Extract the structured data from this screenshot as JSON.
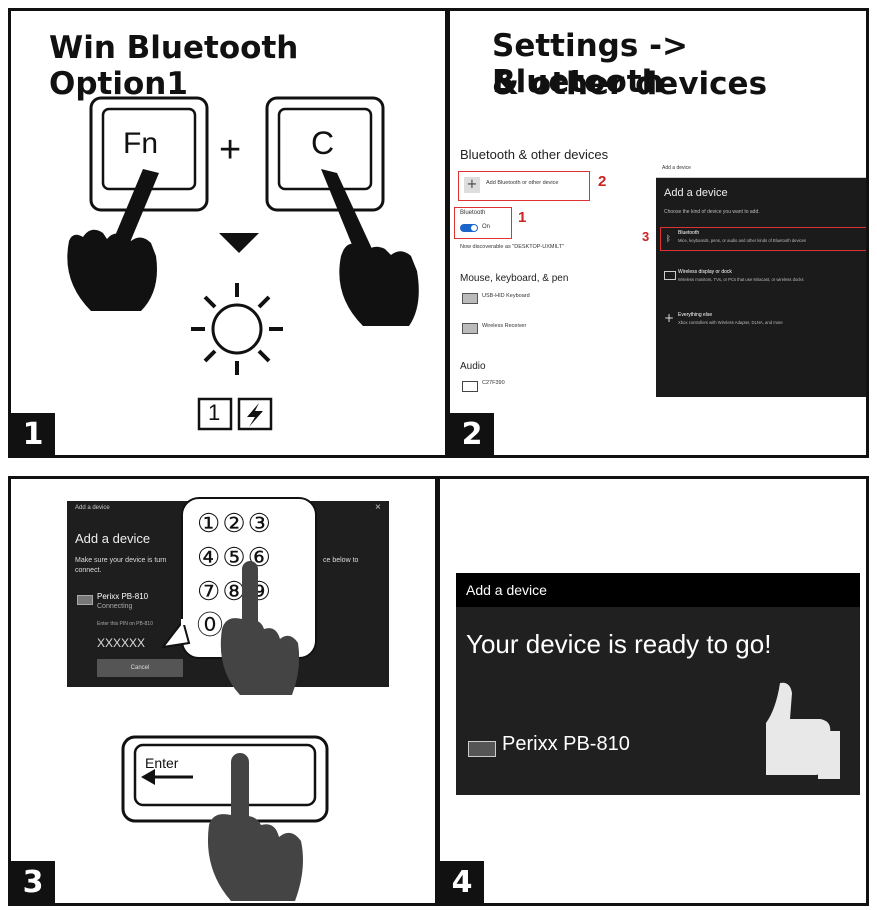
{
  "panel1": {
    "number": "1",
    "title": "Win Bluetooth Option1",
    "key_fn": "Fn",
    "plus": "+",
    "key_c": "C",
    "fkey_label": "1"
  },
  "panel2": {
    "number": "2",
    "title_line1": "Settings -> Bluetooth",
    "title_line2": "& other devices",
    "section_heading": "Bluetooth & other devices",
    "add_device_label": "Add Bluetooth or other device",
    "callout_2": "2",
    "bluetooth_label": "Bluetooth",
    "toggle_state": "On",
    "callout_1": "1",
    "discoverable_text": "Now discoverable as \"DESKTOP-UXMILT\"",
    "mouse_heading": "Mouse, keyboard, & pen",
    "mouse_items": [
      "USB-HID Keyboard",
      "Wireless Receiver"
    ],
    "audio_heading": "Audio",
    "audio_item": "C27F390",
    "dialog": {
      "titlebar": "Add a device",
      "heading": "Add a device",
      "subtext": "Choose the kind of device you want to add.",
      "callout_3": "3",
      "options": [
        {
          "title": "Bluetooth",
          "desc": "Mice, keyboards, pens, or audio and other kinds of Bluetooth devices"
        },
        {
          "title": "Wireless display or dock",
          "desc": "Wireless monitors, TVs, or PCs that use Miracast, or wireless docks"
        },
        {
          "title": "Everything else",
          "desc": "Xbox controllers with Wireless Adapter, DLNA, and more"
        }
      ]
    }
  },
  "panel3": {
    "number": "3",
    "dialog": {
      "titlebar": "Add a device",
      "close": "×",
      "heading": "Add a device",
      "subtext_left": "Make sure your device is turn",
      "subtext_right": "ce below to",
      "subtext_line2": "connect.",
      "device_name": "Perixx PB-810",
      "device_status": "Connecting",
      "pin_prompt": "Enter this PIN on PB-810",
      "pin_value": "XXXXXX",
      "cancel": "Cancel"
    },
    "keypad": [
      "①",
      "②",
      "③",
      "④",
      "⑤",
      "⑥",
      "⑦",
      "⑧",
      "⑨",
      "⓪"
    ],
    "enter_key": "Enter"
  },
  "panel4": {
    "number": "4",
    "titlebar": "Add a device",
    "message": "Your device is ready to go!",
    "device_name": "Perixx PB-810"
  }
}
